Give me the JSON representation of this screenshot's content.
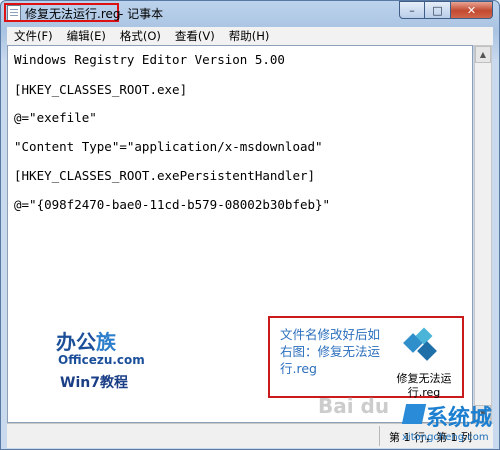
{
  "window": {
    "filename": "修复无法运行.reg",
    "separator_app": "- 记事本",
    "controls": {
      "minimize": "–",
      "maximize": "□",
      "close": "✕"
    }
  },
  "menu": [
    {
      "label": "文件(F)"
    },
    {
      "label": "编辑(E)"
    },
    {
      "label": "格式(O)"
    },
    {
      "label": "查看(V)"
    },
    {
      "label": "帮助(H)"
    }
  ],
  "editor": {
    "lines": [
      "Windows Registry Editor Version 5.00",
      "[HKEY_CLASSES_ROOT.exe]",
      "@=\"exefile\"",
      "\"Content Type\"=\"application/x-msdownload\"",
      "[HKEY_CLASSES_ROOT.exePersistentHandler]",
      "@=\"{098f2470-bae0-11cd-b579-08002b30bfeb}\""
    ]
  },
  "status": {
    "position": "第 1 行，第 1 列"
  },
  "logo": {
    "main_prefix": "办公",
    "main_accent": "族",
    "site": "Officezu.com",
    "tagline": "Win7教程"
  },
  "note": {
    "text": "文件名修改好后如右图：修复无法运行.reg",
    "file_label": "修复无法运行.reg"
  },
  "watermarks": {
    "brand": "系统城",
    "url": "xitongcheng.com",
    "baidu": "Bai du"
  }
}
